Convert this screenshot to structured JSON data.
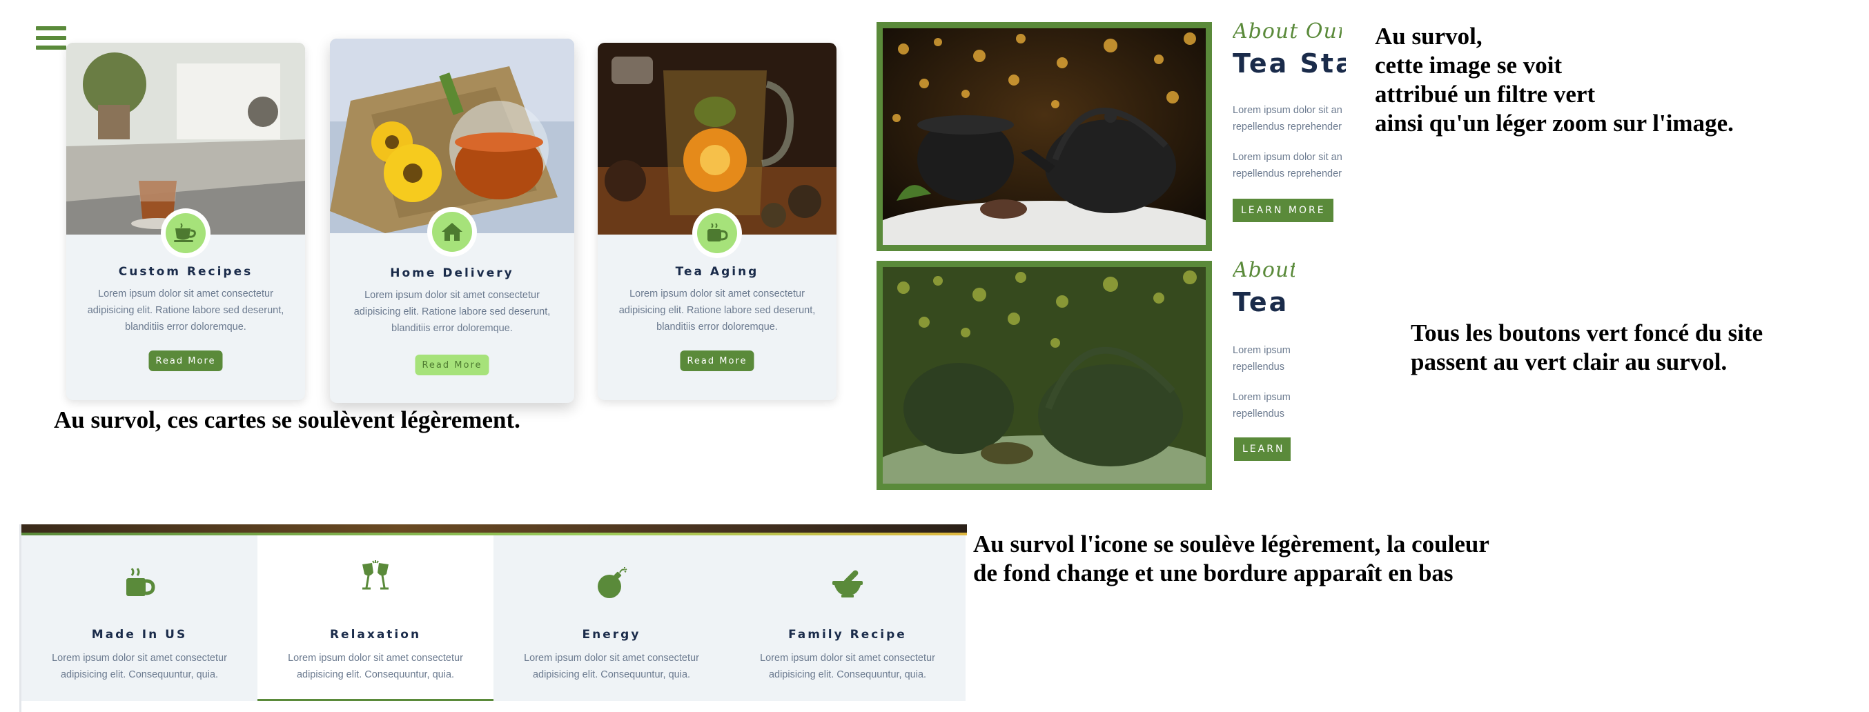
{
  "cards": [
    {
      "title": "Custom Recipes",
      "desc": "Lorem ipsum dolor sit amet consectetur adipisicing elit. Ratione labore sed deserunt, blanditiis error doloremque.",
      "button": "Read More",
      "icon": "tea-cup-icon"
    },
    {
      "title": "Home Delivery",
      "desc": "Lorem ipsum dolor sit amet consectetur adipisicing elit. Ratione labore sed deserunt, blanditiis error doloremque.",
      "button": "Read More",
      "icon": "home-icon"
    },
    {
      "title": "Tea Aging",
      "desc": "Lorem ipsum dolor sit amet consectetur adipisicing elit. Ratione labore sed deserunt, blanditiis error doloremque.",
      "button": "Read More",
      "icon": "mug-icon"
    }
  ],
  "notes": {
    "cards_hover": "Au survol, ces cartes se soulèvent légèrement.",
    "image_hover_1": "Au survol,",
    "image_hover_2": "cette image se voit",
    "image_hover_3": "attribué un filtre  vert",
    "image_hover_4": "ainsi qu'un léger zoom sur l'image.",
    "buttons_hover_1": "Tous les boutons vert foncé du site",
    "buttons_hover_2": "passent au vert clair au survol.",
    "icons_hover_1": "Au survol l'icone se soulève légèrement, la couleur",
    "icons_hover_2": "de fond change et une bordure apparaît en bas"
  },
  "about_top": {
    "script": "About Our",
    "title": "Tea Stat",
    "text1_line1": "Lorem ipsum dolor sit an",
    "text1_line2": "repellendus reprehender",
    "text2_line1": "Lorem ipsum dolor sit an",
    "text2_line2": "repellendus reprehender",
    "button": "LEARN MORE"
  },
  "about_bottom": {
    "script": "About",
    "title": "Tea",
    "text1_line1": "Lorem ipsum",
    "text1_line2": "repellendus",
    "text2_line1": "Lorem ipsum",
    "text2_line2": "repellendus",
    "button": "LEARN"
  },
  "features": [
    {
      "title": "Made In US",
      "desc": "Lorem ipsum dolor sit amet consectetur adipisicing elit. Consequuntur, quia.",
      "icon": "coffee-mug-icon"
    },
    {
      "title": "Relaxation",
      "desc": "Lorem ipsum dolor sit amet consectetur adipisicing elit. Consequuntur, quia.",
      "icon": "toast-glasses-icon"
    },
    {
      "title": "Energy",
      "desc": "Lorem ipsum dolor sit amet consectetur adipisicing elit. Consequuntur, quia.",
      "icon": "bomb-icon"
    },
    {
      "title": "Family Recipe",
      "desc": "Lorem ipsum dolor sit amet consectetur adipisicing elit. Consequuntur, quia.",
      "icon": "mortar-pestle-icon"
    }
  ],
  "colors": {
    "green_dark": "#5a8a3a",
    "green_light": "#a6e27a",
    "navy": "#1a2b4a",
    "card_bg": "#eff3f6"
  }
}
